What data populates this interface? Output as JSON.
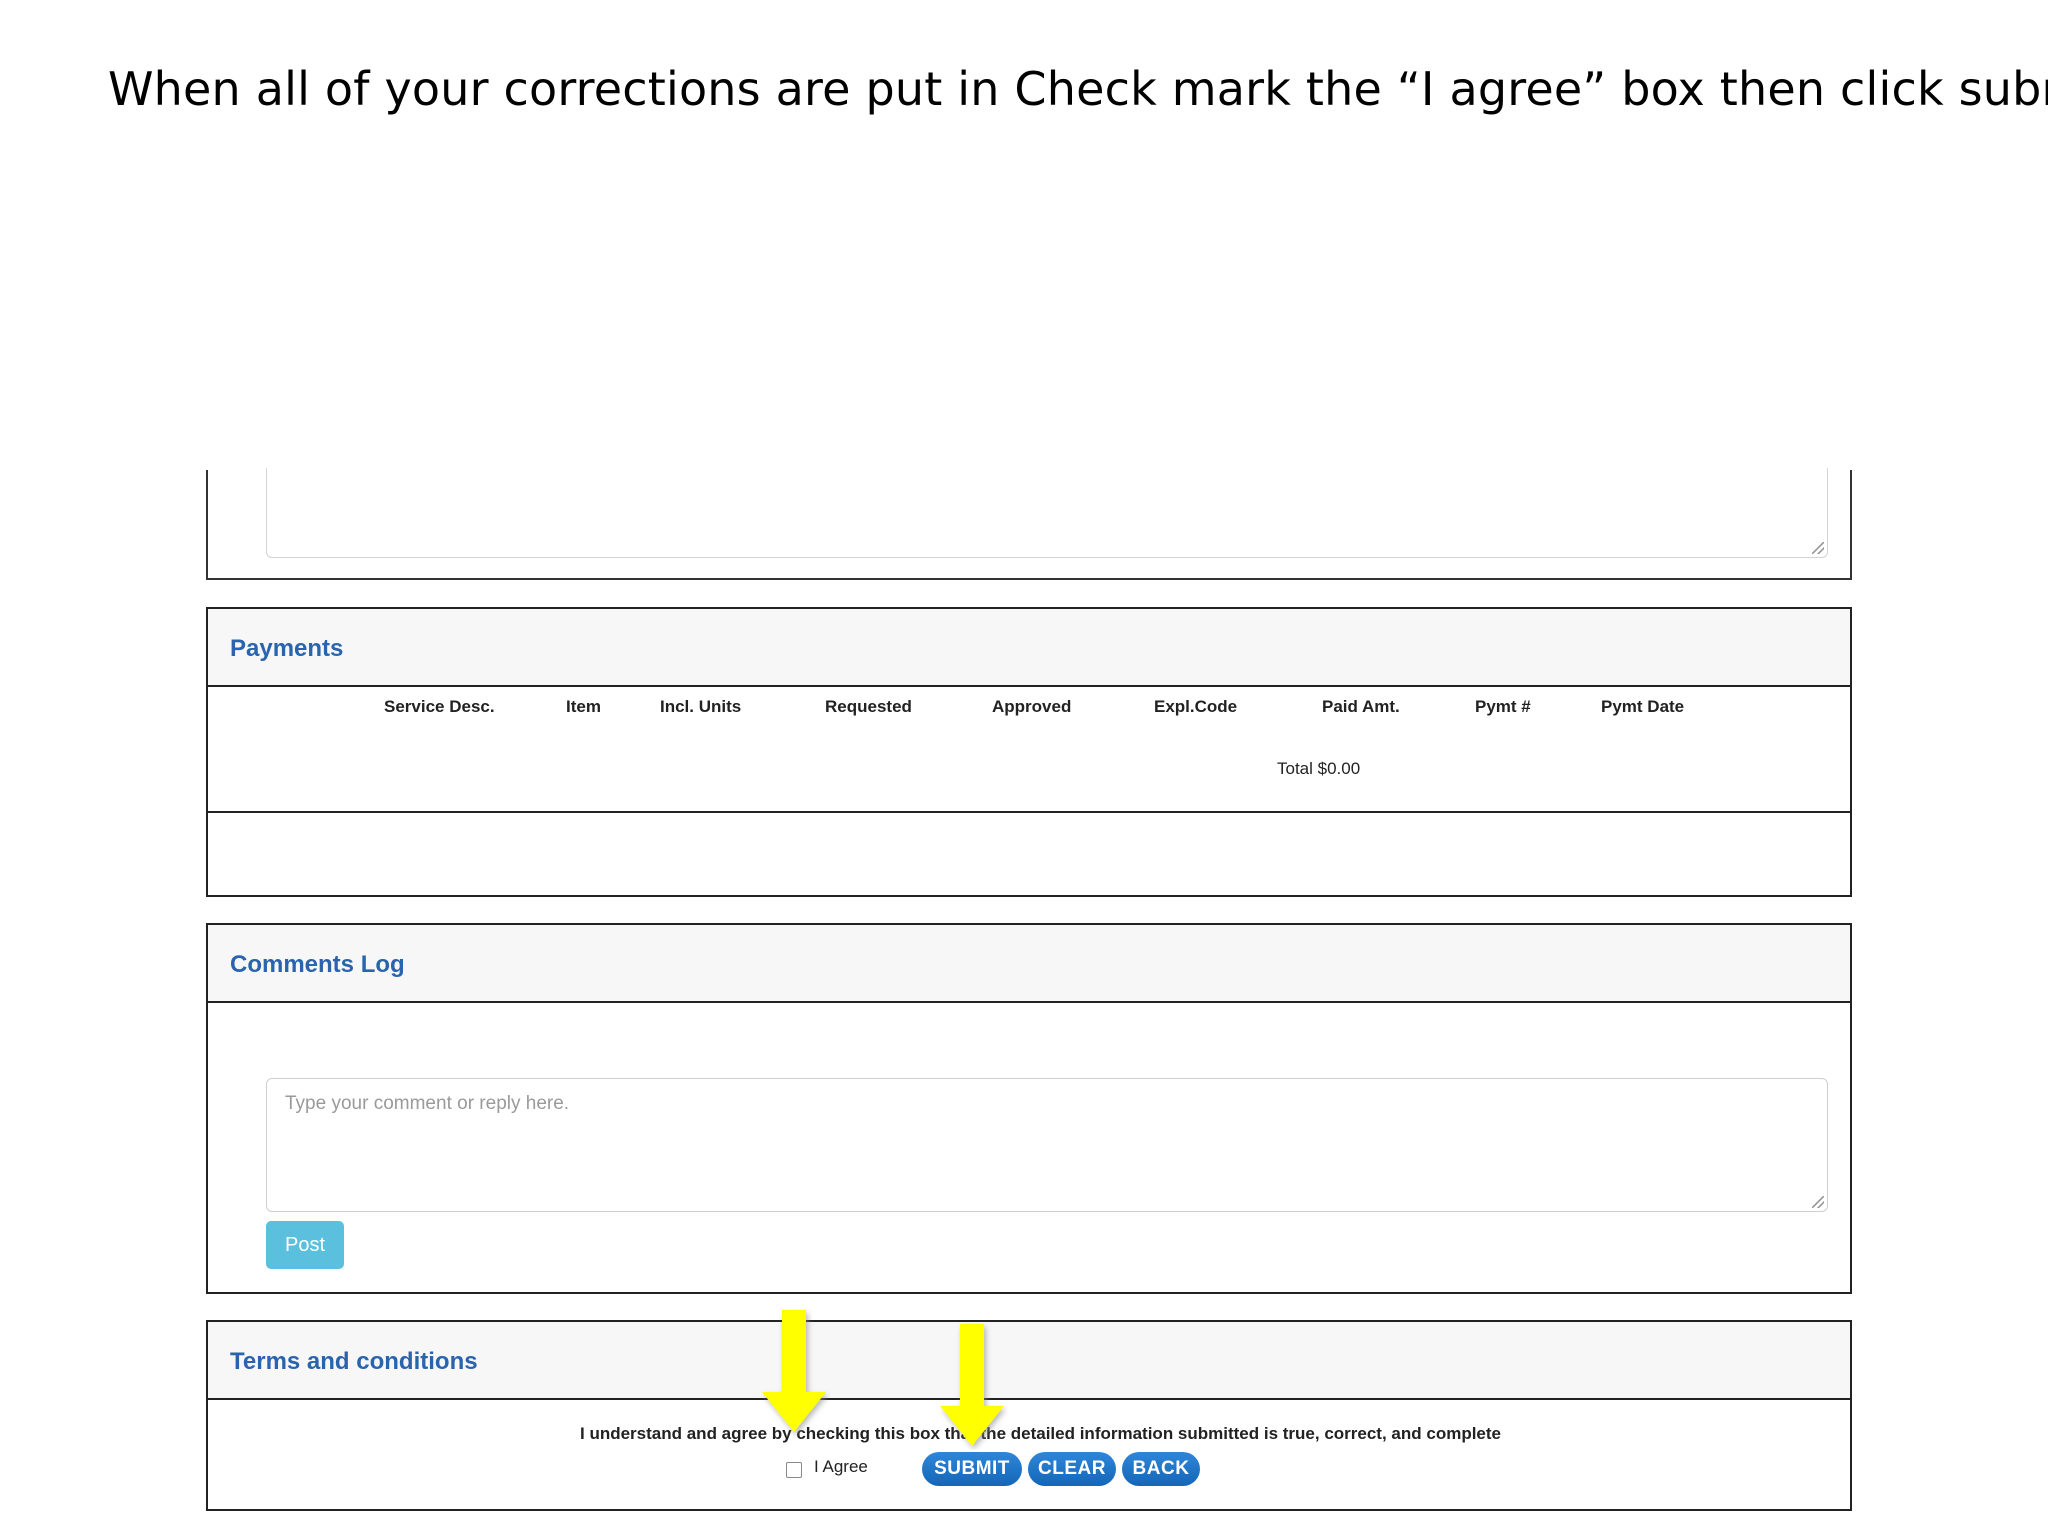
{
  "slide": {
    "instruction": "When all of your corrections are put in Check mark the “I agree” box then click submit"
  },
  "payments": {
    "title": "Payments",
    "columns": [
      "Service Desc.",
      "Item",
      "Incl. Units",
      "Requested",
      "Approved",
      "Expl.Code",
      "Paid Amt.",
      "Pymt #",
      "Pymt Date"
    ],
    "total": "Total $0.00"
  },
  "comments": {
    "title": "Comments Log",
    "placeholder": "Type your comment or reply here.",
    "post_label": "Post"
  },
  "terms": {
    "title": "Terms and conditions",
    "statement": "I understand and agree by checking this box that the detailed information submitted is true, correct, and complete",
    "agree_label": "I Agree",
    "submit_label": "SUBMIT",
    "clear_label": "CLEAR",
    "back_label": "BACK"
  },
  "colors": {
    "section_title": "#2a64ad",
    "post_button": "#5bc0de",
    "action_button": "#1a6fc4",
    "arrow": "#ffff00"
  },
  "icons": [
    "down-arrow-icon",
    "resize-grip-icon"
  ]
}
